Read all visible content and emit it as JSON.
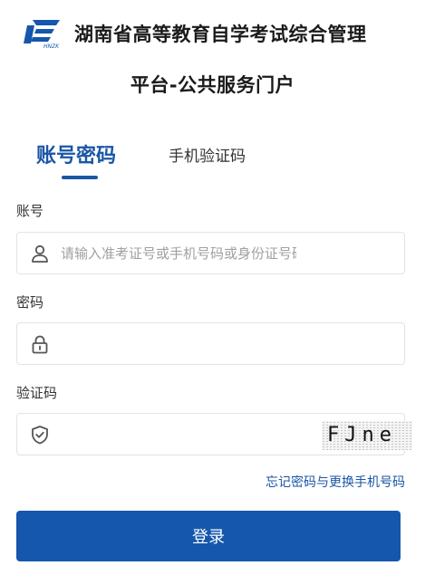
{
  "header": {
    "title_line1": "湖南省高等教育自学考试综合管理",
    "title_line2": "平台-公共服务门户",
    "logo_icon": "hnzk-logo-icon"
  },
  "tabs": [
    {
      "label": "账号密码",
      "active": true
    },
    {
      "label": "手机验证码",
      "active": false
    }
  ],
  "form": {
    "account": {
      "label": "账号",
      "placeholder": "请输入准考证号或手机号码或身份证号码",
      "value": "",
      "icon": "user-icon"
    },
    "password": {
      "label": "密码",
      "placeholder": "",
      "value": "",
      "icon": "lock-icon"
    },
    "captcha": {
      "label": "验证码",
      "placeholder": "",
      "value": "",
      "icon": "shield-check-icon",
      "image_text": "FJne"
    }
  },
  "links": {
    "forgot": "忘记密码与更换手机号码"
  },
  "buttons": {
    "login": "登录"
  },
  "colors": {
    "brand": "#1557ac",
    "accent_text": "#1a56a6",
    "border": "#e3e3e3"
  }
}
